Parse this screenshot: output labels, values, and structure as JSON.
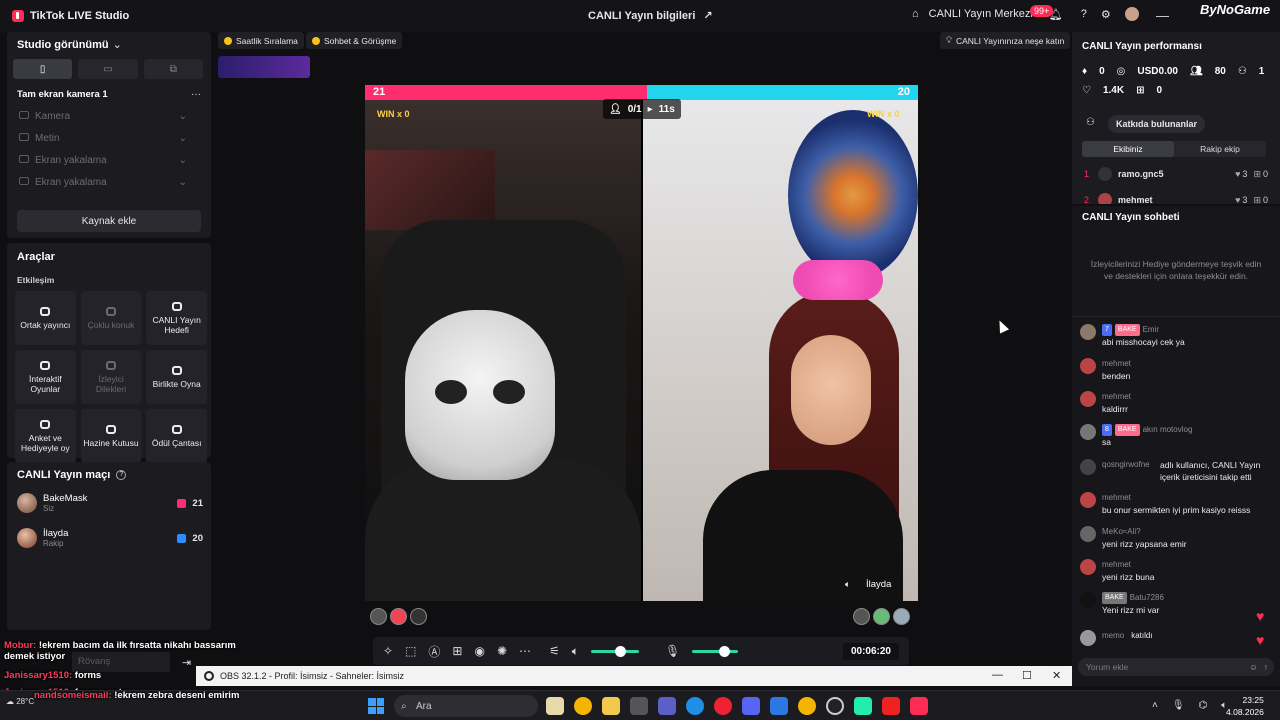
{
  "titlebar": {
    "app_title": "TikTok LIVE Studio",
    "center_title": "CANLI Yayın bilgileri",
    "center_link": "CANLI Yayın Merkezi",
    "notif_count": "99+",
    "brand": "ByNoGame"
  },
  "left": {
    "studio_view_label": "Studio görünümü",
    "scene_label": "Tam ekran kamera 1",
    "more_label": "···",
    "sources": [
      "Kamera",
      "Metin",
      "Ekran yakalama",
      "Ekran yakalama"
    ],
    "add_source": "Kaynak ekle",
    "tools_title": "Araçlar",
    "tools_sub": "Etkileşim",
    "tools": [
      {
        "label": "Ortak yayıncı",
        "dim": false
      },
      {
        "label": "Çoklu konuk",
        "dim": true
      },
      {
        "label": "CANLI Yayın Hedefi",
        "dim": false
      },
      {
        "label": "İnteraktif Oyunlar",
        "dim": false
      },
      {
        "label": "İzleyici Dilekleri",
        "dim": true
      },
      {
        "label": "Birlikte Oyna",
        "dim": false
      },
      {
        "label": "Anket ve Hediyeyle oy",
        "dim": false
      },
      {
        "label": "Hazine Kutusu",
        "dim": false
      },
      {
        "label": "Ödül Çantası",
        "dim": false
      }
    ],
    "match_title": "CANLI Yayın maçı",
    "match": [
      {
        "name": "BakeMask",
        "sub": "Siz",
        "score": "21",
        "color": "#ff2d6f"
      },
      {
        "name": "İlayda",
        "sub": "Rakip",
        "score": "20",
        "color": "#2d8cff"
      }
    ]
  },
  "center": {
    "chips": [
      "Saatlik Sıralama",
      "Sohbet & Görüşme",
      "CANLI Yayınınıza neşe katın"
    ],
    "score_left": "21",
    "score_right": "20",
    "score_left_share": 0.51,
    "win_left": "WIN x 0",
    "win_right": "WIN x 0",
    "round": "0/1",
    "countdown": "11s",
    "opponent_name": "İlayda",
    "timer": "00:06:20",
    "volume_level": 0.6,
    "mic_level": 0.7
  },
  "right": {
    "perf_title": "CANLI Yayın performansı",
    "stats": [
      "0",
      "USD0.00",
      "80",
      "1",
      "1.4K",
      "0"
    ],
    "contributors": "Katkıda bulunanlar",
    "tabs": [
      "Ekibiniz",
      "Rakip ekip"
    ],
    "ranks": [
      {
        "no": "1",
        "name": "ramo.gnc5",
        "a": "3",
        "b": "0"
      },
      {
        "no": "2",
        "name": "mehmet",
        "a": "3",
        "b": "0"
      }
    ],
    "chat_title": "CANLI Yayın sohbeti",
    "chat_empty": "İzleyicilerinizi Hediye göndermeye teşvik edin ve destekleri için onlara teşekkür edin.",
    "messages": [
      {
        "user": "Emir",
        "badges": [
          "7",
          "BAKE"
        ],
        "text": "abi misshocayi cek ya"
      },
      {
        "user": "mehmet",
        "badges": [],
        "text": "benden"
      },
      {
        "user": "mehmet",
        "badges": [],
        "text": "kaldirrr"
      },
      {
        "user": "akın motovlog",
        "badges": [
          "8",
          "BAKE"
        ],
        "text": "sa"
      },
      {
        "user": "qosngirwofne",
        "badges": [],
        "text": "adlı kullanıcı, CANLI Yayın içerik üreticisini takip etti"
      },
      {
        "user": "mehmet",
        "badges": [],
        "text": "bu onur sermikten iyi prim kasiyo reisss"
      },
      {
        "user": "MeKo≈Ali?",
        "badges": [],
        "text": "yeni rizz yapsana emir"
      },
      {
        "user": "mehmet",
        "badges": [],
        "text": "yeni rizz buna"
      },
      {
        "user": "Batu7286",
        "badges": [
          "BAKE"
        ],
        "text": "Yeni rizz mi var"
      },
      {
        "user": "memo",
        "badges": [],
        "text": "katıldı"
      }
    ],
    "chat_placeholder": "Yorum ekle"
  },
  "overlay": [
    {
      "name": "Mobur:",
      "text": "!ekrem bacım da ilk fırsatta nikahı bassarım demek istiyor"
    },
    {
      "name": "Janissary1510:",
      "text": "forms"
    },
    {
      "name": "Janissary1510:",
      "text": "forma şortu"
    },
    {
      "name": "nandsomeismail:",
      "text": "!ekrem zebra deseni emirim"
    }
  ],
  "ghost_input": "Rövanş",
  "obs": {
    "title": "OBS 32.1.2 - Profil: İsimsiz - Sahneler: İsimsiz"
  },
  "taskbar": {
    "search": "Ara",
    "weather": "28°C",
    "time": "23:25",
    "date": "4.08.2026"
  }
}
